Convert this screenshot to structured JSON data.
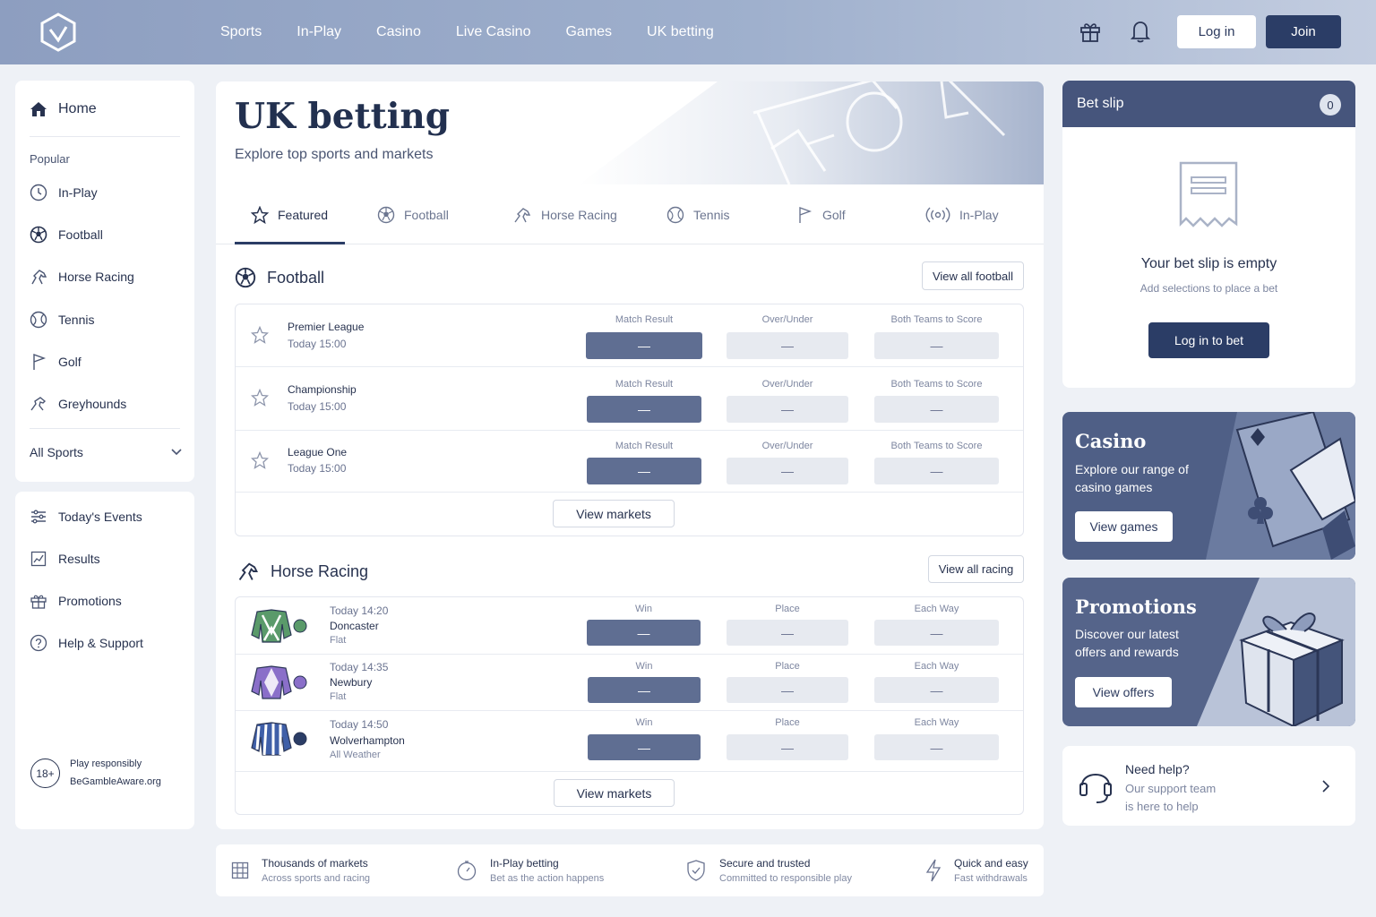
{
  "nav": {
    "items": [
      "Sports",
      "In-Play",
      "Casino",
      "Live Casino",
      "Games",
      "UK betting"
    ],
    "login": "Log in",
    "join": "Join"
  },
  "sidebar": {
    "home": "Home",
    "popular_heading": "Popular",
    "popular": [
      "In-Play",
      "Football",
      "Horse Racing",
      "Tennis",
      "Golf",
      "Greyhounds"
    ],
    "all_sports": "All Sports",
    "links": [
      "Today's Events",
      "Results",
      "Promotions",
      "Help & Support"
    ],
    "responsible": {
      "badge": "18+",
      "line1": "Play responsibly",
      "line2": "BeGambleAware.org"
    }
  },
  "hero": {
    "title": "UK betting",
    "subtitle": "Explore top sports and markets"
  },
  "tabs": [
    "Featured",
    "Football",
    "Horse Racing",
    "Tennis",
    "Golf",
    "In-Play"
  ],
  "football": {
    "title": "Football",
    "view_all": "View all football",
    "markets": [
      "Match Result",
      "Over/Under",
      "Both Teams to Score"
    ],
    "matches": [
      {
        "league": "Premier League",
        "time": "Today 15:00"
      },
      {
        "league": "Championship",
        "time": "Today 15:00"
      },
      {
        "league": "League One",
        "time": "Today 15:00"
      }
    ],
    "placeholder": "—",
    "view_markets": "View markets"
  },
  "racing": {
    "title": "Horse Racing",
    "view_all": "View all racing",
    "markets": [
      "Win",
      "Place",
      "Each Way"
    ],
    "races": [
      {
        "time": "Today 14:20",
        "course": "Doncaster",
        "type": "Flat",
        "silk_color": "#5a9a6a"
      },
      {
        "time": "Today 14:35",
        "course": "Newbury",
        "type": "Flat",
        "silk_color": "#8a6fc9"
      },
      {
        "time": "Today 14:50",
        "course": "Wolverhampton",
        "type": "All Weather",
        "silk_color": "#3f5fa8"
      }
    ],
    "placeholder": "—",
    "view_markets": "View markets"
  },
  "features": [
    {
      "title": "Thousands of markets",
      "sub": "Across sports and racing"
    },
    {
      "title": "In-Play betting",
      "sub": "Bet as the action happens"
    },
    {
      "title": "Secure and trusted",
      "sub": "Committed to responsible play"
    },
    {
      "title": "Quick and easy",
      "sub": "Fast withdrawals"
    }
  ],
  "betslip": {
    "title": "Bet slip",
    "count": "0",
    "empty_title": "Your bet slip is empty",
    "empty_sub": "Add selections to place a bet",
    "button": "Log in to bet"
  },
  "casino": {
    "title": "Casino",
    "sub": "Explore our range of casino games",
    "button": "View games"
  },
  "promotions": {
    "title": "Promotions",
    "sub": "Discover our latest offers and rewards",
    "button": "View offers"
  },
  "help": {
    "title": "Need help?",
    "sub1": "Our support team",
    "sub2": "is here to help"
  }
}
